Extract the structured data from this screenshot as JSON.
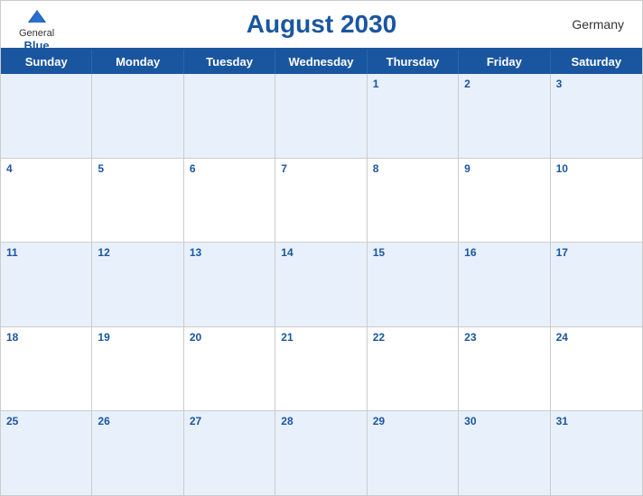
{
  "header": {
    "title": "August 2030",
    "country": "Germany",
    "logo": {
      "general": "General",
      "blue": "Blue"
    }
  },
  "dayHeaders": [
    "Sunday",
    "Monday",
    "Tuesday",
    "Wednesday",
    "Thursday",
    "Friday",
    "Saturday"
  ],
  "weeks": [
    {
      "rowType": "blue",
      "days": [
        {
          "date": "",
          "empty": true
        },
        {
          "date": "",
          "empty": true
        },
        {
          "date": "",
          "empty": true
        },
        {
          "date": "",
          "empty": true
        },
        {
          "date": "1"
        },
        {
          "date": "2"
        },
        {
          "date": "3"
        }
      ]
    },
    {
      "rowType": "white",
      "days": [
        {
          "date": "4"
        },
        {
          "date": "5"
        },
        {
          "date": "6"
        },
        {
          "date": "7"
        },
        {
          "date": "8"
        },
        {
          "date": "9"
        },
        {
          "date": "10"
        }
      ]
    },
    {
      "rowType": "blue",
      "days": [
        {
          "date": "11"
        },
        {
          "date": "12"
        },
        {
          "date": "13"
        },
        {
          "date": "14"
        },
        {
          "date": "15"
        },
        {
          "date": "16"
        },
        {
          "date": "17"
        }
      ]
    },
    {
      "rowType": "white",
      "days": [
        {
          "date": "18"
        },
        {
          "date": "19"
        },
        {
          "date": "20"
        },
        {
          "date": "21"
        },
        {
          "date": "22"
        },
        {
          "date": "23"
        },
        {
          "date": "24"
        }
      ]
    },
    {
      "rowType": "blue",
      "days": [
        {
          "date": "25"
        },
        {
          "date": "26"
        },
        {
          "date": "27"
        },
        {
          "date": "28"
        },
        {
          "date": "29"
        },
        {
          "date": "30"
        },
        {
          "date": "31"
        }
      ]
    }
  ]
}
